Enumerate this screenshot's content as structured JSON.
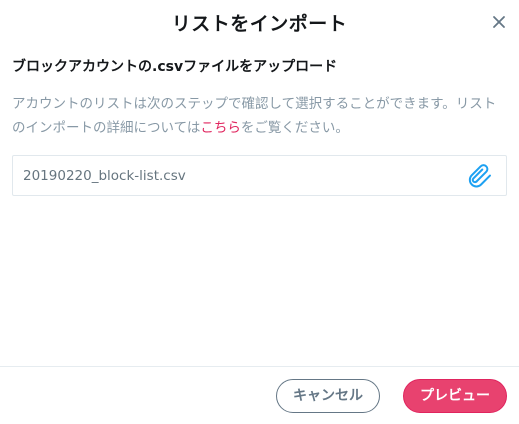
{
  "dialog": {
    "title": "リストをインポート",
    "close_icon": "close-icon",
    "heading": "ブロックアカウントの.csvファイルをアップロード",
    "description_before_link": "アカウントのリストは次のステップで確認して選択することができます。リストのインポートの詳細については",
    "description_link": "こちら",
    "description_after_link": "をご覧ください。",
    "file": {
      "name": "20190220_block-list.csv",
      "attach_icon": "paperclip-icon"
    },
    "buttons": {
      "cancel": "キャンセル",
      "preview": "プレビュー"
    },
    "colors": {
      "accent": "#e8426f",
      "link": "#e0245e",
      "attach_icon": "#1da1f2",
      "muted_text": "#8899a6"
    }
  }
}
